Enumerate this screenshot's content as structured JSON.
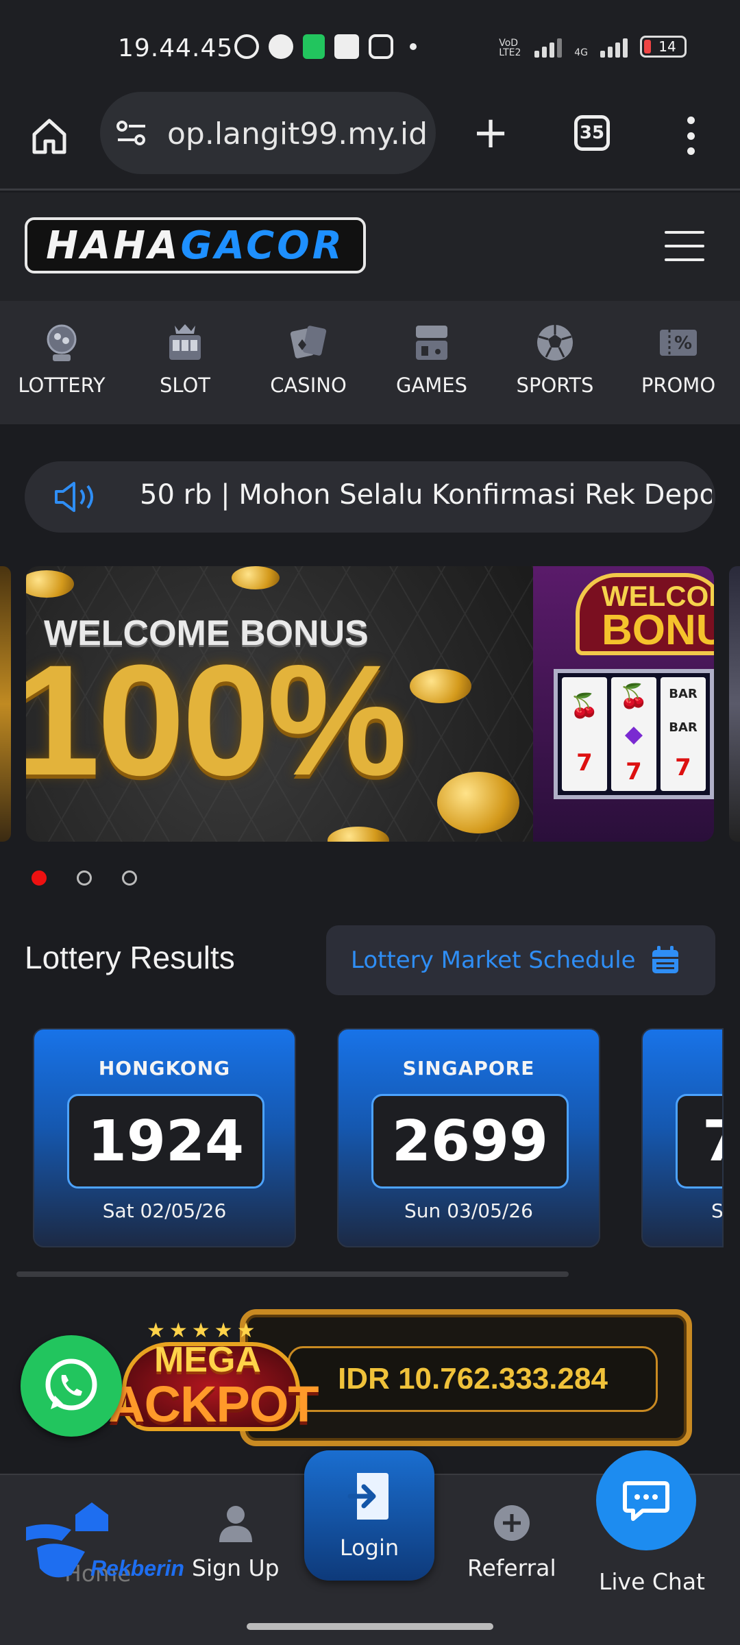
{
  "status_bar": {
    "time": "19.44.45",
    "battery": "14",
    "net_label_1": "VoD LTE2",
    "net_label_2": "4G"
  },
  "browser": {
    "url": "op.langit99.my.id",
    "tab_count": "35"
  },
  "site": {
    "logo_part1": "HAHA",
    "logo_part2": "GACOR"
  },
  "categories": [
    {
      "label": "LOTTERY",
      "icon": "lottery-icon"
    },
    {
      "label": "SLOT",
      "icon": "slot-icon"
    },
    {
      "label": "CASINO",
      "icon": "casino-icon"
    },
    {
      "label": "GAMES",
      "icon": "games-icon"
    },
    {
      "label": "SPORTS",
      "icon": "sports-icon"
    },
    {
      "label": "PROMO",
      "icon": "promo-icon"
    }
  ],
  "marquee": {
    "text": "50 rb | Mohon Selalu Konfirmasi Rek Depo"
  },
  "banner": {
    "title": "WELCOME BONUS",
    "percent": "100%",
    "sign_line1": "WELCOME",
    "sign_line2": "BONUS",
    "active_slide": 1,
    "slide_count": 3
  },
  "lottery": {
    "title": "Lottery Results",
    "schedule_button": "Lottery Market Schedule",
    "cards": [
      {
        "market": "HONGKONG",
        "number": "1924",
        "date": "Sat 02/05/26"
      },
      {
        "market": "SINGAPORE",
        "number": "2699",
        "date": "Sun 03/05/26"
      },
      {
        "market": "",
        "number": "7",
        "date": "S"
      }
    ]
  },
  "jackpot": {
    "badge_top": "MEGA",
    "badge_bottom": "JACKPOT",
    "value": "IDR 10.762.333.284"
  },
  "bottom_nav": {
    "home": "Home",
    "signup": "Sign Up",
    "login": "Login",
    "referral": "Referral",
    "livechat": "Live Chat",
    "partner_logo": "Rekberin"
  },
  "colors": {
    "accent": "#1d8cf0",
    "brand_blue": "#1e90ff",
    "gold": "#f0c23a",
    "whatsapp": "#22c55e"
  }
}
